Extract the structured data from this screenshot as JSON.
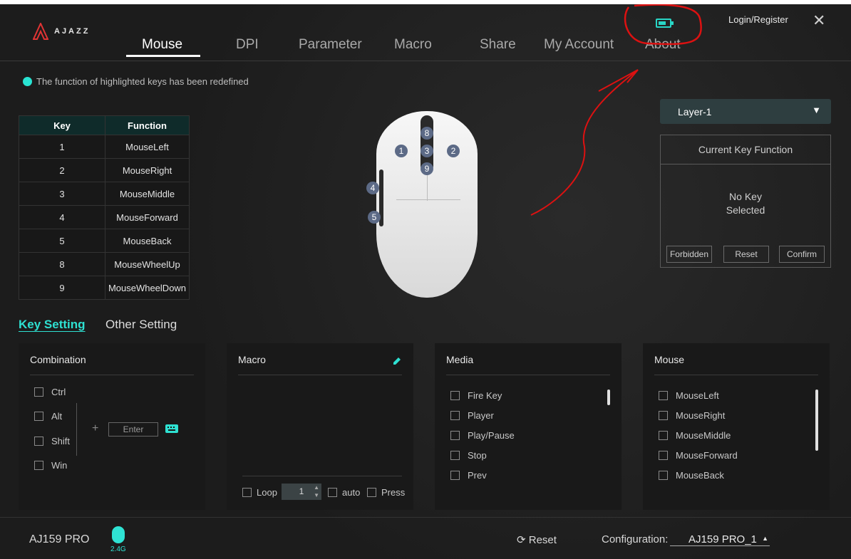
{
  "header": {
    "brand": "AJAZZ",
    "login_label": "Login/Register",
    "nav": [
      "Mouse",
      "DPI",
      "Parameter",
      "Macro",
      "Share",
      "My Account",
      "About"
    ]
  },
  "notice": "The function of highlighted keys has been redefined",
  "key_table": {
    "headers": [
      "Key",
      "Function"
    ],
    "rows": [
      [
        "1",
        "MouseLeft"
      ],
      [
        "2",
        "MouseRight"
      ],
      [
        "3",
        "MouseMiddle"
      ],
      [
        "4",
        "MouseForward"
      ],
      [
        "5",
        "MouseBack"
      ],
      [
        "8",
        "MouseWheelUp"
      ],
      [
        "9",
        "MouseWheelDown"
      ]
    ]
  },
  "mouse_badges": [
    "8",
    "1",
    "3",
    "2",
    "9",
    "4",
    "5"
  ],
  "layer": {
    "selected": "Layer-1"
  },
  "current_key": {
    "title": "Current Key Function",
    "msg_line1": "No Key",
    "msg_line2": "Selected",
    "buttons": [
      "Forbidden",
      "Reset",
      "Confirm"
    ]
  },
  "tabs": [
    "Key Setting",
    "Other Setting"
  ],
  "panels": {
    "combination": {
      "title": "Combination",
      "items": [
        "Ctrl",
        "Alt",
        "Shift",
        "Win"
      ],
      "plus": "+",
      "enter_placeholder": "Enter"
    },
    "macro": {
      "title": "Macro",
      "loop_label": "Loop",
      "loop_value": "1",
      "auto_label": "auto",
      "press_label": "Press"
    },
    "media": {
      "title": "Media",
      "items": [
        "Fire Key",
        "Player",
        "Play/Pause",
        "Stop",
        "Prev"
      ]
    },
    "mouse": {
      "title": "Mouse",
      "items": [
        "MouseLeft",
        "MouseRight",
        "MouseMiddle",
        "MouseForward",
        "MouseBack"
      ]
    }
  },
  "footer": {
    "device": "AJ159 PRO",
    "connection": "2.4G",
    "reset_label": "Reset",
    "config_label": "Configuration:",
    "config_value": "AJ159 PRO_1"
  },
  "colors": {
    "accent": "#2ee0d1",
    "background": "#1f1f1f"
  },
  "icons": [
    "ajazz-logo-icon",
    "battery-icon",
    "close-icon",
    "pencil-icon",
    "keyboard-icon",
    "reset-icon",
    "mouse-device-icon"
  ]
}
